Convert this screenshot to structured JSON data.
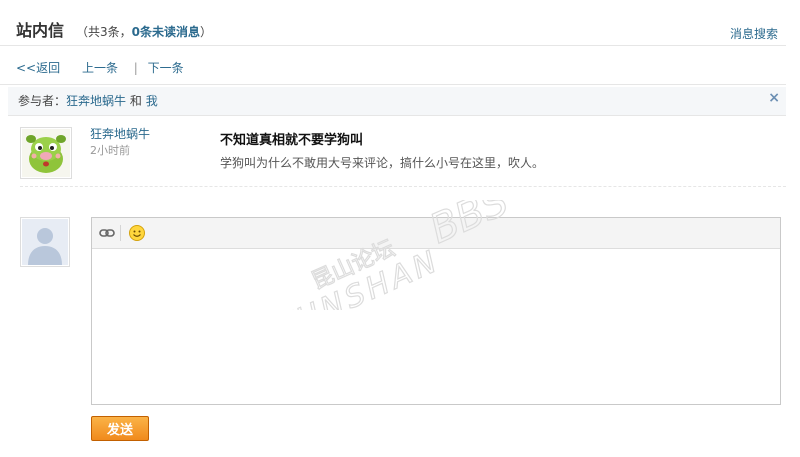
{
  "header": {
    "title": "站内信",
    "summary_open": "（共3条，",
    "unread_count": "0条未读消息",
    "summary_close": "）",
    "search_link": "消息搜索"
  },
  "nav": {
    "back": "<<返回",
    "prev": "上一条",
    "separator": "|",
    "next": "下一条"
  },
  "participants": {
    "label": "参与者：",
    "user": "狂奔地蜗牛",
    "and": "和",
    "me": "我",
    "close": "×"
  },
  "message": {
    "sender": "狂奔地蜗牛",
    "time": "2小时前",
    "subject": "不知道真相就不要学狗叫",
    "body": "学狗叫为什么不敢用大号来评论，搞什么小号在这里，吹人。"
  },
  "editor": {
    "value": "",
    "icons": [
      "link-icon",
      "smiley-icon"
    ]
  },
  "send_button": "发送",
  "watermark": {
    "brand_cn": "昆山论坛",
    "brand_en": "KUNSHAN",
    "brand_bbs": "BBS"
  },
  "colors": {
    "link": "#2b6a8e",
    "button": "#f08a1c"
  }
}
